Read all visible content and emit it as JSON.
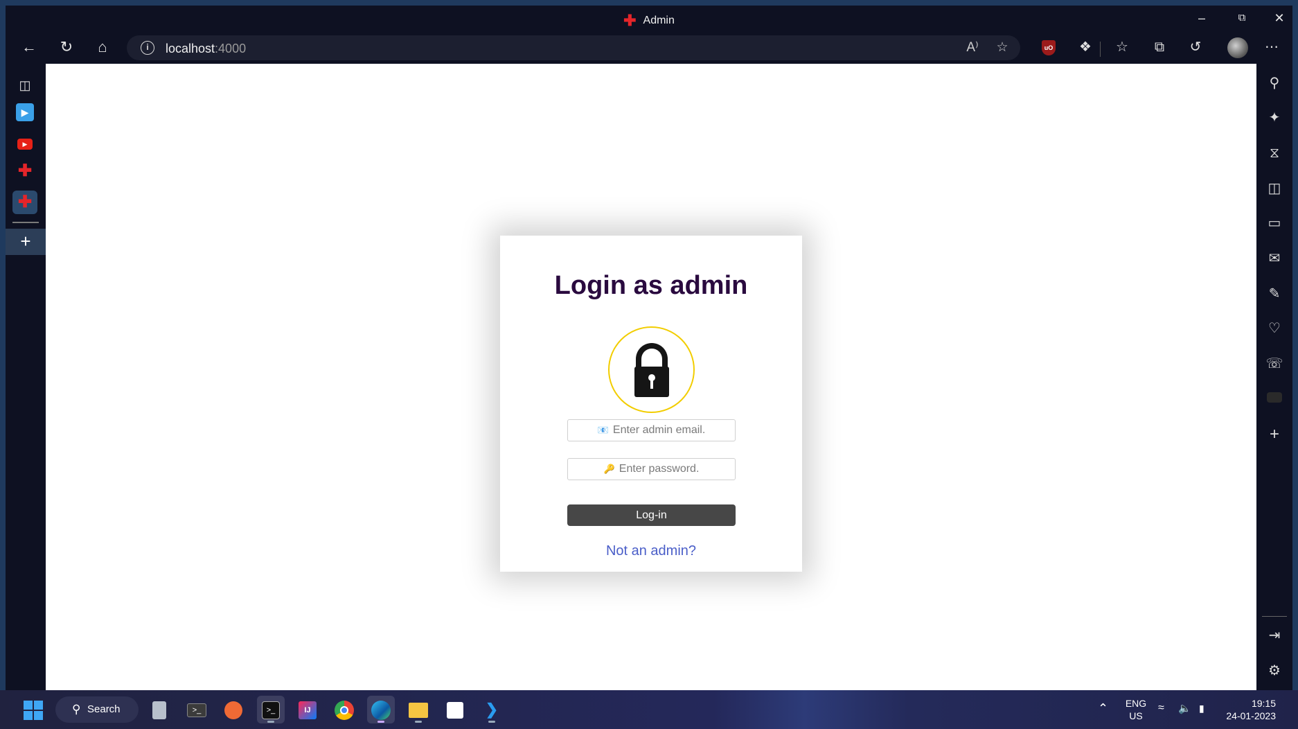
{
  "window": {
    "title": "Admin"
  },
  "browser": {
    "url_host": "localhost",
    "url_port": ":4000"
  },
  "login": {
    "heading": "Login as admin",
    "email_placeholder": "Enter admin email.",
    "password_placeholder": "Enter password.",
    "login_label": "Log-in",
    "not_admin_link": "Not an admin?"
  },
  "taskbar": {
    "search_label": "Search",
    "lang_top": "ENG",
    "lang_bottom": "US",
    "time": "19:15",
    "date": "24-01-2023"
  },
  "colors": {
    "heading": "#2a0a3f",
    "lock_ring": "#f2cd00",
    "login_button": "#474747",
    "link": "#4a5ec8",
    "tab_cross": "#e5252a"
  }
}
